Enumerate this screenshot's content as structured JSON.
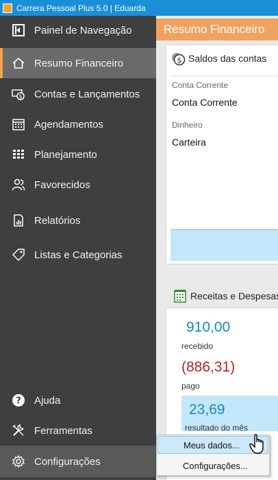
{
  "window": {
    "title": "Carrera Pessoal Plus 5.0 | Eduarda"
  },
  "sidebar": {
    "header": "Painel de Navegação",
    "items": [
      {
        "label": "Resumo Financeiro",
        "icon": "home-icon"
      },
      {
        "label": "Contas e Lançamentos",
        "icon": "money-icon"
      },
      {
        "label": "Agendamentos",
        "icon": "calendar-icon"
      },
      {
        "label": "Planejamento",
        "icon": "grid-icon"
      },
      {
        "label": "Favorecidos",
        "icon": "people-icon"
      },
      {
        "label": "Relatórios",
        "icon": "report-icon"
      },
      {
        "label": "Listas e Categorias",
        "icon": "tag-icon"
      }
    ],
    "bottom": [
      {
        "label": "Ajuda",
        "icon": "help-icon"
      },
      {
        "label": "Ferramentas",
        "icon": "tools-icon"
      },
      {
        "label": "Configurações",
        "icon": "gear-icon"
      }
    ]
  },
  "main": {
    "header": "Resumo Financeiro",
    "balances": {
      "title": "Saldos das contas",
      "groups": [
        {
          "label": "Conta Corrente",
          "account": "Conta Corrente"
        },
        {
          "label": "Dinheiro",
          "account": "Carteira"
        }
      ]
    },
    "income_expense": {
      "title": "Receitas e Despesas",
      "received_value": "910,00",
      "received_label": "recebido",
      "paid_value": "(886,31)",
      "paid_label": "pago",
      "result_value": "23,69",
      "result_label": "resultado do mês"
    }
  },
  "context_menu": {
    "items": [
      "Meus dados...",
      "Configurações..."
    ]
  },
  "colors": {
    "titlebar": "#1a8fd8",
    "sidebar": "#3f3f3f",
    "accent": "#f0a360",
    "positive": "#1a86c8",
    "negative": "#b22222",
    "highlight": "#c3e7fb"
  }
}
